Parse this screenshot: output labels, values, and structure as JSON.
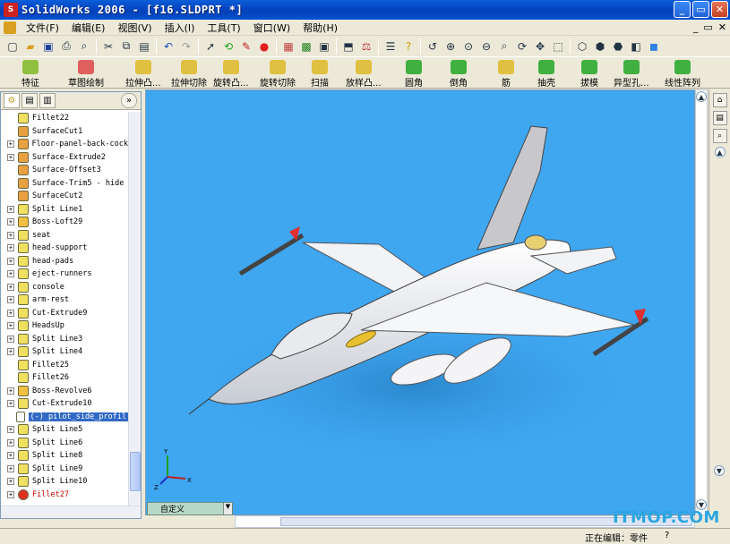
{
  "window": {
    "title": "SolidWorks 2006 - [f16.SLDPRT *]",
    "minimize": "_",
    "restore": "▭",
    "close": "✕"
  },
  "menu": {
    "items": [
      "文件(F)",
      "编辑(E)",
      "视图(V)",
      "插入(I)",
      "工具(T)",
      "窗口(W)",
      "帮助(H)"
    ],
    "doc_controls": [
      "_",
      "▭",
      "✕"
    ]
  },
  "features_toolbar": {
    "buttons": [
      "特征",
      "草图绘制",
      "拉伸凸...",
      "拉伸切除",
      "旋转凸...",
      "旋转切除",
      "扫描",
      "放样凸...",
      "圆角",
      "倒角",
      "筋",
      "抽壳",
      "拔模",
      "异型孔...",
      "线性阵列"
    ]
  },
  "tree": {
    "items": [
      {
        "label": "Fillet22",
        "expander": "",
        "icon": "fillet-icon",
        "color": "#f0e060"
      },
      {
        "label": "SurfaceCut1",
        "expander": "",
        "icon": "surface-cut-icon",
        "color": "#e8a040"
      },
      {
        "label": "Floor-panel-back-cock",
        "expander": "+",
        "icon": "surface-icon",
        "color": "#e8a040"
      },
      {
        "label": "Surface-Extrude2",
        "expander": "+",
        "icon": "surface-extrude-icon",
        "color": "#e8a040"
      },
      {
        "label": "Surface-Offset3",
        "expander": "",
        "icon": "surface-offset-icon",
        "color": "#e8a040"
      },
      {
        "label": "Surface-Trim5 - hide",
        "expander": "",
        "icon": "surface-trim-icon",
        "color": "#e8a040"
      },
      {
        "label": "SurfaceCut2",
        "expander": "",
        "icon": "surface-cut-icon",
        "color": "#e8a040"
      },
      {
        "label": "Split Line1",
        "expander": "+",
        "icon": "split-line-icon",
        "color": "#f0e060"
      },
      {
        "label": "Boss-Loft29",
        "expander": "+",
        "icon": "loft-icon",
        "color": "#f0c040"
      },
      {
        "label": "seat",
        "expander": "+",
        "icon": "extrude-icon",
        "color": "#f0e060"
      },
      {
        "label": "head-support",
        "expander": "+",
        "icon": "extrude-icon",
        "color": "#f0e060"
      },
      {
        "label": "head-pads",
        "expander": "+",
        "icon": "extrude-icon",
        "color": "#f0e060"
      },
      {
        "label": "eject-runners",
        "expander": "+",
        "icon": "extrude-icon",
        "color": "#f0e060"
      },
      {
        "label": "console",
        "expander": "+",
        "icon": "extrude-icon",
        "color": "#f0e060"
      },
      {
        "label": "arm-rest",
        "expander": "+",
        "icon": "extrude-icon",
        "color": "#f0e060"
      },
      {
        "label": "Cut-Extrude9",
        "expander": "+",
        "icon": "cut-extrude-icon",
        "color": "#f0e060"
      },
      {
        "label": "HeadsUp",
        "expander": "+",
        "icon": "extrude-icon",
        "color": "#f0e060"
      },
      {
        "label": "Split Line3",
        "expander": "+",
        "icon": "split-line-icon",
        "color": "#f0e060"
      },
      {
        "label": "Split Line4",
        "expander": "+",
        "icon": "split-line-icon",
        "color": "#f0e060"
      },
      {
        "label": "Fillet25",
        "expander": "",
        "icon": "fillet-icon",
        "color": "#f0e060"
      },
      {
        "label": "Fillet26",
        "expander": "",
        "icon": "fillet-icon",
        "color": "#f0e060"
      },
      {
        "label": "Boss-Revolve6",
        "expander": "+",
        "icon": "revolve-icon",
        "color": "#f0c040"
      },
      {
        "label": "Cut-Extrude10",
        "expander": "+",
        "icon": "cut-extrude-icon",
        "color": "#f0e060"
      },
      {
        "label": "(-) pilot_side_profil",
        "expander": "",
        "icon": "sketch-icon",
        "color": "#ffffff",
        "selected": true
      },
      {
        "label": "Split Line5",
        "expander": "+",
        "icon": "split-line-icon",
        "color": "#f0e060"
      },
      {
        "label": "Split Line6",
        "expander": "+",
        "icon": "split-line-icon",
        "color": "#f0e060"
      },
      {
        "label": "Split Line8",
        "expander": "+",
        "icon": "split-line-icon",
        "color": "#f0e060"
      },
      {
        "label": "Split Line9",
        "expander": "+",
        "icon": "split-line-icon",
        "color": "#f0e060"
      },
      {
        "label": "Split Line10",
        "expander": "+",
        "icon": "split-line-icon",
        "color": "#f0e060"
      },
      {
        "label": "Fillet27",
        "expander": "+",
        "icon": "error-icon",
        "color": "#e03020",
        "error": true
      }
    ]
  },
  "viewport": {
    "background": "#3fa6f0",
    "triad_labels": [
      "Y",
      "X",
      "Z"
    ]
  },
  "config_tab": {
    "label": "自定义"
  },
  "status": {
    "text": "正在编辑：零件",
    "help": "?"
  },
  "watermark": {
    "text": "ITMOP.COM"
  }
}
